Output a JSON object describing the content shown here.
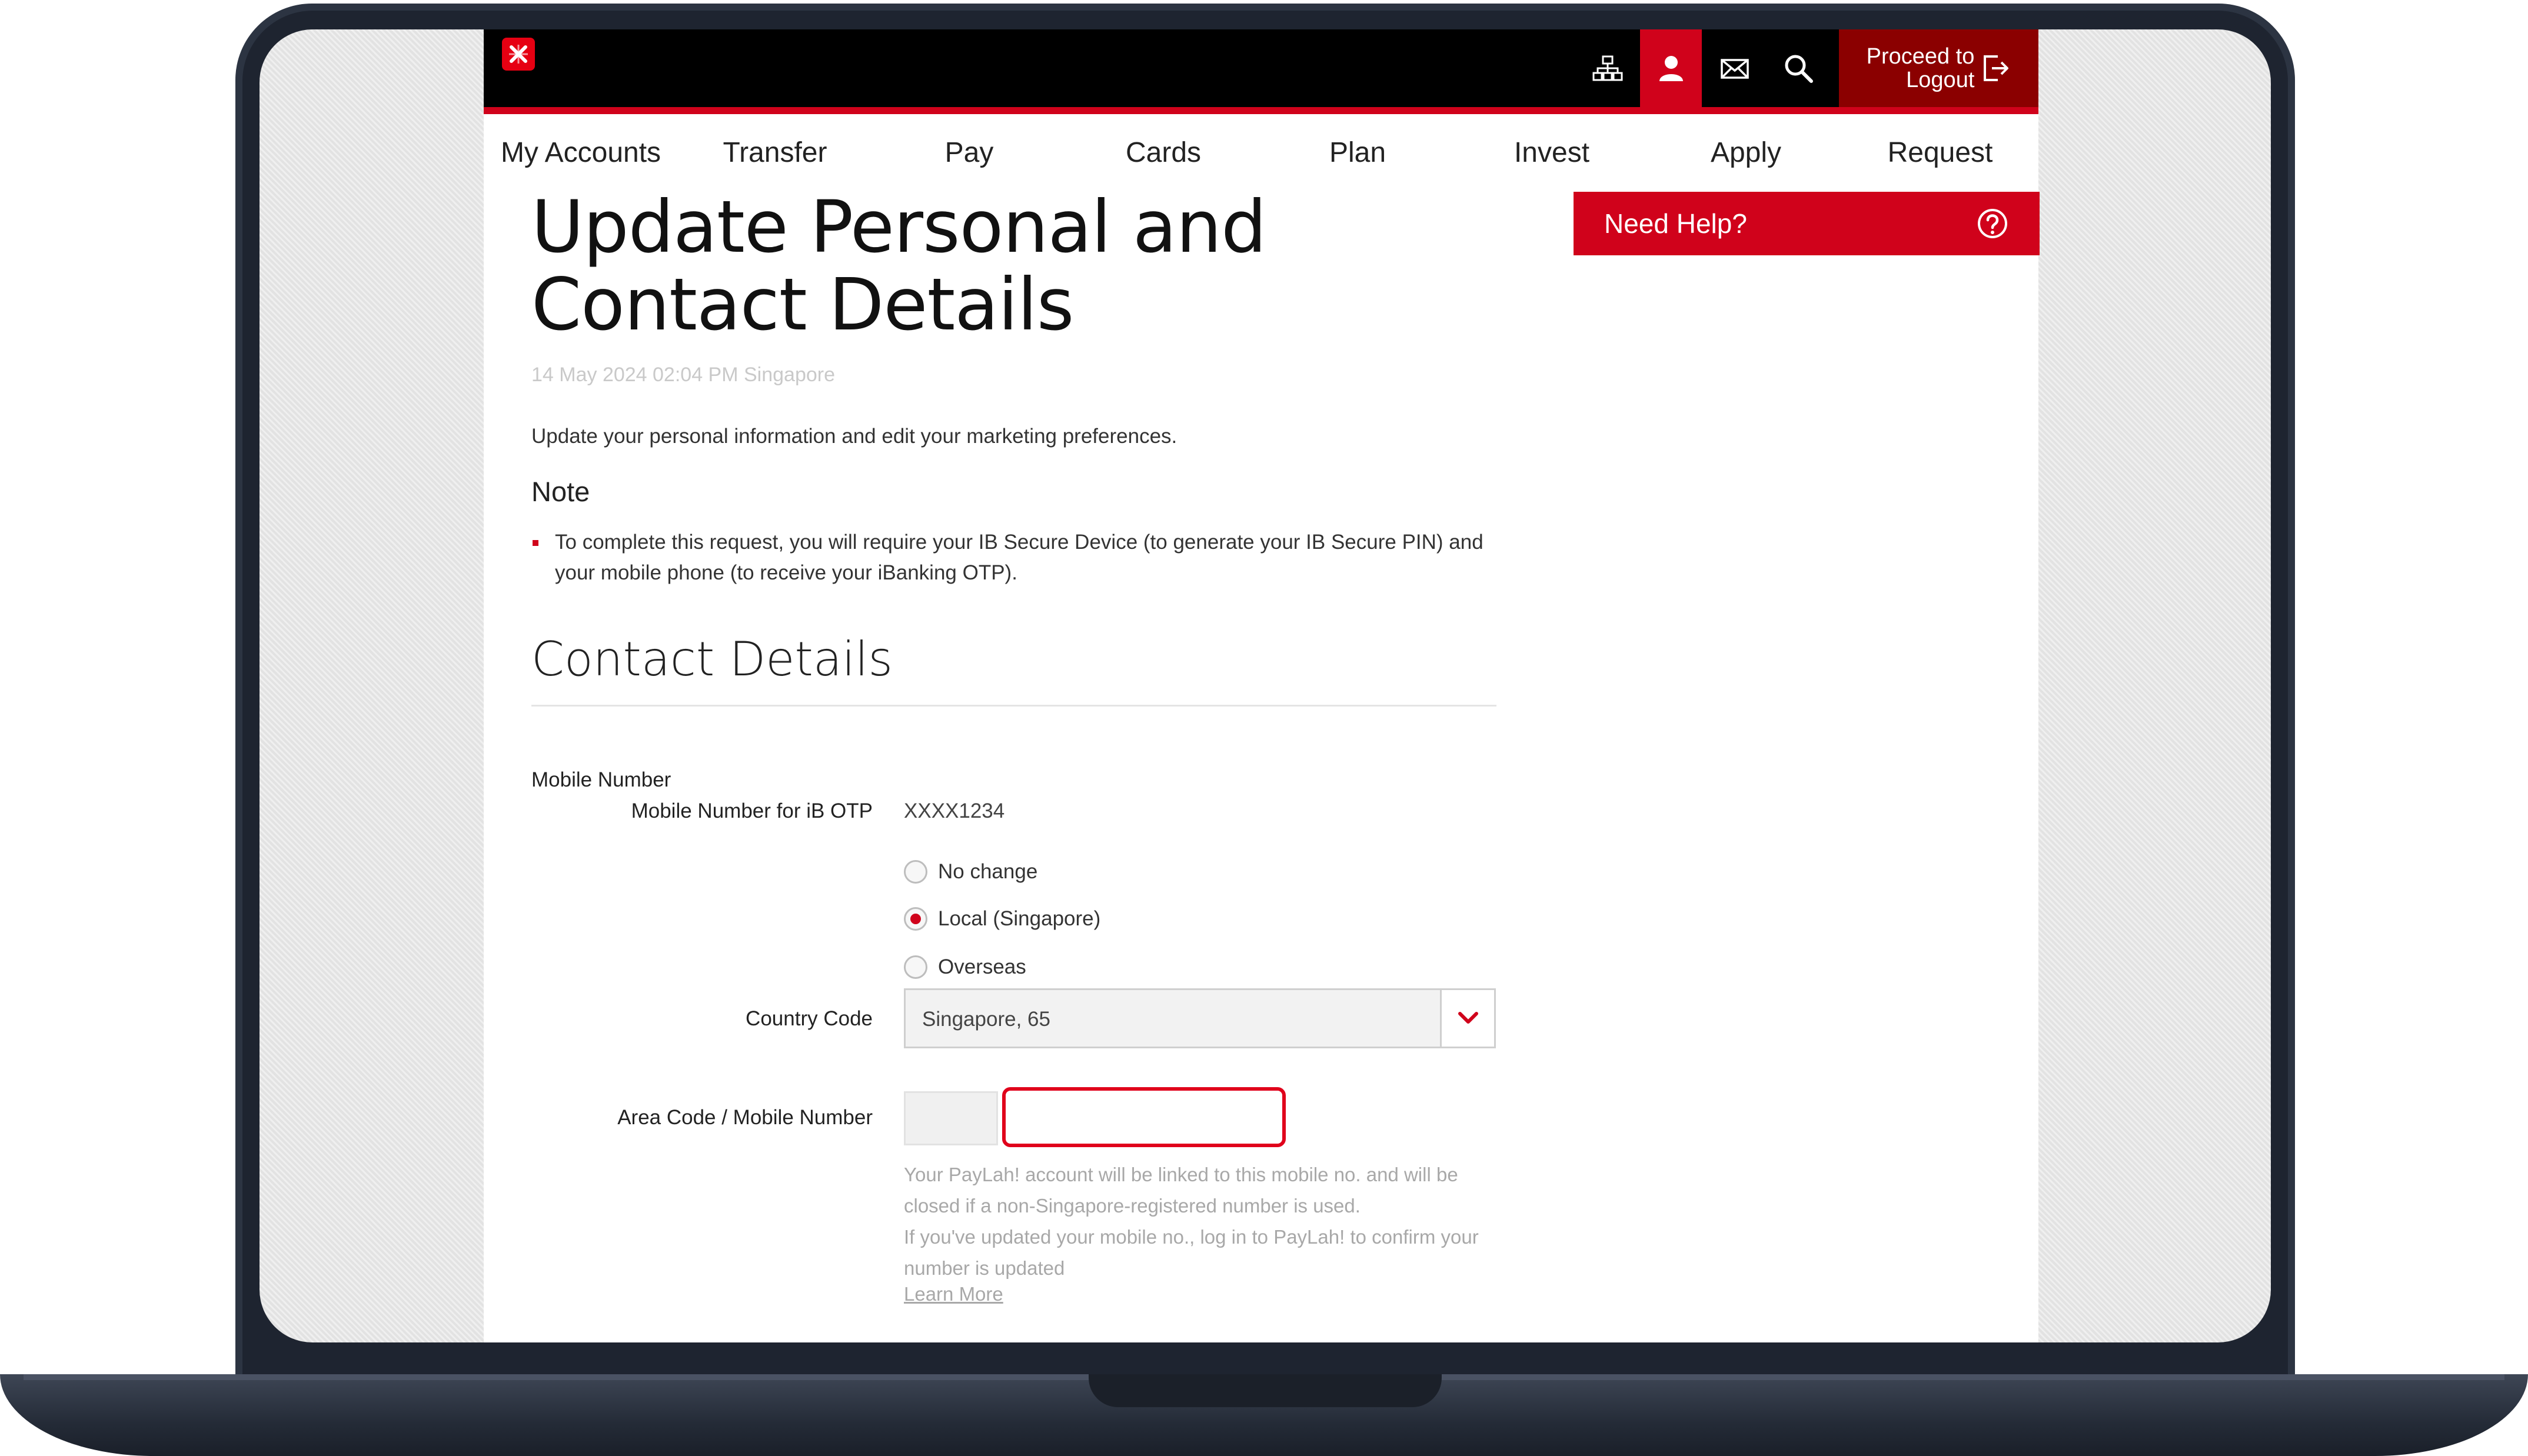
{
  "topbar": {
    "logout_line1": "Proceed to",
    "logout_line2": "Logout",
    "icons": [
      "sitemap-icon",
      "profile-icon",
      "mail-icon",
      "search-icon",
      "logout-icon"
    ]
  },
  "nav": {
    "items": [
      "My Accounts",
      "Transfer",
      "Pay",
      "Cards",
      "Plan",
      "Invest",
      "Apply",
      "Request"
    ]
  },
  "page": {
    "title": "Update Personal and Contact Details",
    "timestamp": "14 May 2024 02:04 PM Singapore",
    "intro": "Update your personal information and edit your marketing preferences.",
    "note_heading": "Note",
    "note_text": "To complete this request, you will require your IB Secure Device (to generate your IB Secure PIN) and your mobile phone (to receive your iBanking OTP)."
  },
  "contact": {
    "section_title": "Contact Details",
    "mobile_label": "Mobile Number",
    "otp_label": "Mobile Number for iB OTP",
    "otp_value": "XXXX1234",
    "radio_options": [
      "No change",
      "Local (Singapore)",
      "Overseas"
    ],
    "selected_option": "Local (Singapore)",
    "country_code_label": "Country Code",
    "country_code_value": "Singapore, 65",
    "area_mobile_label": "Area Code / Mobile Number",
    "area_code_value": "",
    "mobile_value": "",
    "helper_line1": "Your PayLah! account will be linked to this mobile no. and will be closed if a non-Singapore-registered number is used.",
    "helper_line2": "If you've updated your mobile no., log in to PayLah! to confirm your number is updated",
    "learn_more": "Learn More"
  },
  "help": {
    "label": "Need Help?"
  },
  "colors": {
    "brand_red": "#d0021b",
    "dark_red": "#8b0000",
    "topbar": "#000000"
  }
}
